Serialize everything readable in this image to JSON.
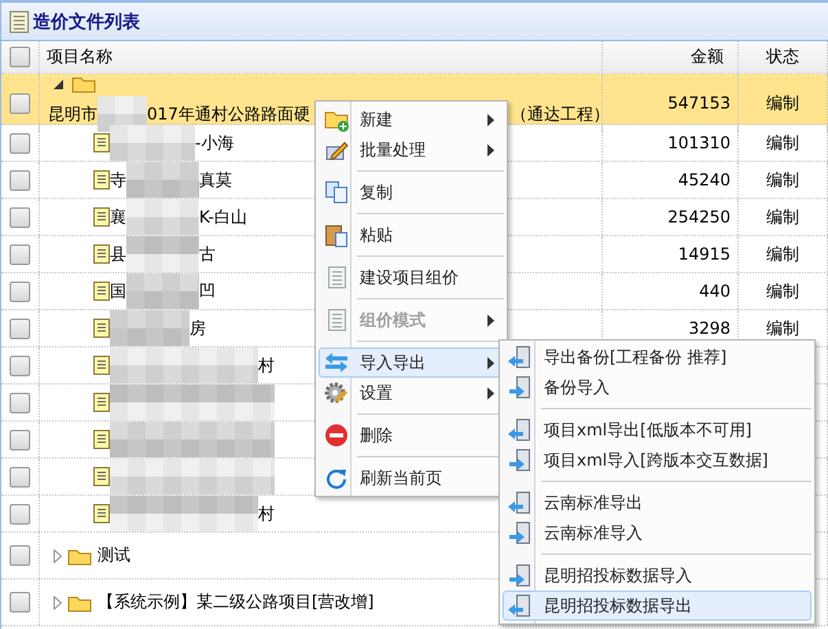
{
  "panel": {
    "title": "造价文件列表"
  },
  "table": {
    "select_all_checked": false,
    "columns": [
      {
        "label": "项目名称"
      },
      {
        "label": "金额"
      },
      {
        "label": "状态"
      }
    ],
    "rows": [
      {
        "kind": "folder",
        "expanded": true,
        "selected": true,
        "checked": false,
        "name_parts": [
          "昆明市",
          "017年通村公路路面硬",
          "（通达工程）"
        ],
        "amount": "547153",
        "status": "编制",
        "children": [
          {
            "kind": "file",
            "checked": false,
            "name_parts": [
              "-小海"
            ],
            "amount": "101310",
            "status": "编制"
          },
          {
            "kind": "file",
            "checked": false,
            "name_parts": [
              "寺",
              "真莫"
            ],
            "amount": "45240",
            "status": "编制"
          },
          {
            "kind": "file",
            "checked": false,
            "name_parts": [
              "襄",
              "K-白山"
            ],
            "amount": "254250",
            "status": "编制"
          },
          {
            "kind": "file",
            "checked": false,
            "name_parts": [
              "县",
              "古"
            ],
            "amount": "14915",
            "status": "编制"
          },
          {
            "kind": "file",
            "checked": false,
            "name_parts": [
              "国",
              "凹"
            ],
            "amount": "440",
            "status": "编制"
          },
          {
            "kind": "file",
            "checked": false,
            "name_parts": [
              "房"
            ],
            "amount": "3298",
            "status": "编制"
          },
          {
            "kind": "file",
            "checked": false,
            "name_parts": [
              "村"
            ]
          },
          {
            "kind": "file",
            "checked": false
          },
          {
            "kind": "file",
            "checked": false
          },
          {
            "kind": "file",
            "checked": false
          },
          {
            "kind": "file",
            "checked": false,
            "name_parts": [
              "村"
            ]
          }
        ]
      },
      {
        "kind": "folder",
        "expanded": false,
        "selected": false,
        "checked": false,
        "name_parts": [
          "测试"
        ]
      },
      {
        "kind": "folder",
        "expanded": false,
        "selected": false,
        "checked": false,
        "name_parts": [
          "【系统示例】某二级公路项目[营改增]"
        ]
      }
    ]
  },
  "context_menu": {
    "items": [
      {
        "kind": "item",
        "label": "新建",
        "submenu": true,
        "disabled": false,
        "selected": false
      },
      {
        "kind": "item",
        "label": "批量处理",
        "submenu": true,
        "disabled": false,
        "selected": false
      },
      {
        "kind": "separator"
      },
      {
        "kind": "item",
        "label": "复制",
        "submenu": false,
        "disabled": false,
        "selected": false
      },
      {
        "kind": "separator"
      },
      {
        "kind": "item",
        "label": "粘贴",
        "submenu": false,
        "disabled": false,
        "selected": false
      },
      {
        "kind": "separator"
      },
      {
        "kind": "item",
        "label": "建设项目组价",
        "submenu": false,
        "disabled": false,
        "selected": false
      },
      {
        "kind": "separator"
      },
      {
        "kind": "item",
        "label": "组价模式",
        "submenu": true,
        "disabled": true,
        "selected": false
      },
      {
        "kind": "separator"
      },
      {
        "kind": "item",
        "label": "导入导出",
        "submenu": true,
        "disabled": false,
        "selected": true
      },
      {
        "kind": "item",
        "label": "设置",
        "submenu": true,
        "disabled": false,
        "selected": false
      },
      {
        "kind": "separator"
      },
      {
        "kind": "item",
        "label": "删除",
        "submenu": false,
        "disabled": false,
        "selected": false
      },
      {
        "kind": "separator"
      },
      {
        "kind": "item",
        "label": "刷新当前页",
        "submenu": false,
        "disabled": false,
        "selected": false
      }
    ]
  },
  "submenu": {
    "items": [
      {
        "kind": "export",
        "label": "导出备份[工程备份 推荐]",
        "selected": false
      },
      {
        "kind": "import",
        "label": "备份导入",
        "selected": false
      },
      {
        "kind": "separator"
      },
      {
        "kind": "export",
        "label": "项目xml导出[低版本不可用]",
        "selected": false
      },
      {
        "kind": "import",
        "label": "项目xml导入[跨版本交互数据]",
        "selected": false
      },
      {
        "kind": "separator"
      },
      {
        "kind": "export",
        "label": "云南标准导出",
        "selected": false
      },
      {
        "kind": "import",
        "label": "云南标准导入",
        "selected": false
      },
      {
        "kind": "separator"
      },
      {
        "kind": "import",
        "label": "昆明招投标数据导入",
        "selected": false
      },
      {
        "kind": "export",
        "label": "昆明招投标数据导出",
        "selected": true
      }
    ]
  }
}
